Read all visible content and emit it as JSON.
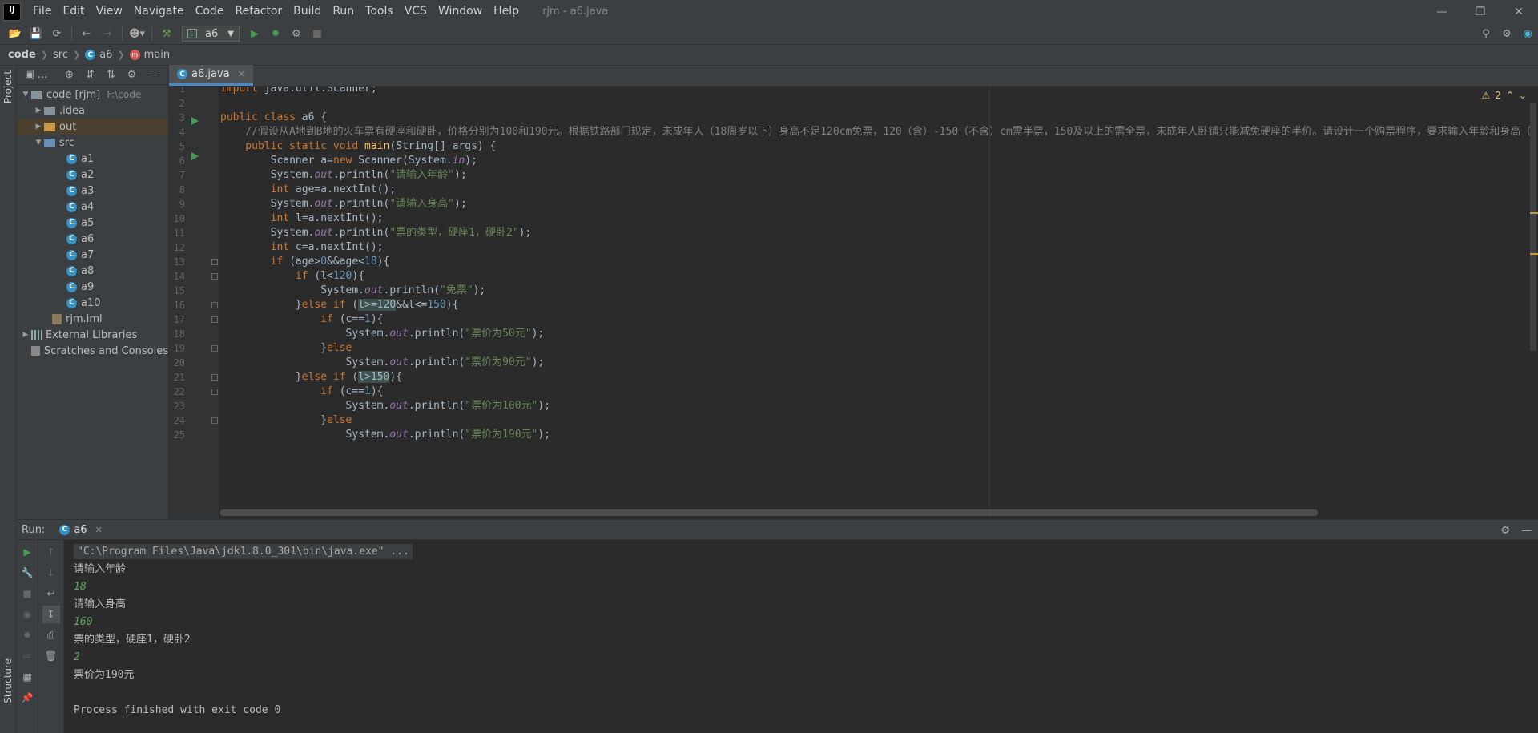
{
  "menubar": {
    "logo": "IJ",
    "items": [
      "File",
      "Edit",
      "View",
      "Navigate",
      "Code",
      "Refactor",
      "Build",
      "Run",
      "Tools",
      "VCS",
      "Window",
      "Help"
    ],
    "window_title": "rjm - a6.java"
  },
  "toolbar": {
    "run_config": "a6"
  },
  "breadcrumb": {
    "items": [
      "code",
      "src",
      "a6",
      "main"
    ]
  },
  "left_strip": {
    "project_label": "Project",
    "structure_label": "Structure"
  },
  "project": {
    "header_dropdown": "...",
    "root_label": "code [rjm]",
    "root_path": "F:\\code",
    "idea": ".idea",
    "out": "out",
    "src": "src",
    "classes": [
      "a1",
      "a2",
      "a3",
      "a4",
      "a5",
      "a6",
      "a7",
      "a8",
      "a9",
      "a10"
    ],
    "iml": "rjm.iml",
    "external_libraries": "External Libraries",
    "scratches": "Scratches and Consoles"
  },
  "editor": {
    "tab_label": "a6.java",
    "warnings": "2",
    "lines": [
      {
        "n": "1",
        "segs": [
          [
            "kw",
            "import "
          ],
          [
            "",
            "java.util.Scanner;"
          ]
        ]
      },
      {
        "n": "2",
        "segs": []
      },
      {
        "n": "3",
        "segs": [
          [
            "kw",
            "public class "
          ],
          [
            "",
            "a6 {"
          ]
        ]
      },
      {
        "n": "4",
        "segs": [
          [
            "cmt",
            "    //假设从A地到B地的火车票有硬座和硬卧，价格分别为100和190元。根据铁路部门规定，未成年人（18周岁以下）身高不足120cm免票，120（含）-150（不含）cm需半票，150及以上的需全票，未成年人卧铺只能减免硬座的半价。请设计一个购票程序，要求输入年龄和身高（"
          ]
        ]
      },
      {
        "n": "5",
        "segs": [
          [
            "kw",
            "    public static void "
          ],
          [
            "fn",
            "main"
          ],
          [
            "",
            "(String[] args) {"
          ]
        ]
      },
      {
        "n": "6",
        "segs": [
          [
            "",
            "        Scanner a="
          ],
          [
            "kw",
            "new "
          ],
          [
            "",
            "Scanner(System."
          ],
          [
            "fld",
            "in"
          ],
          [
            "",
            ");"
          ]
        ]
      },
      {
        "n": "7",
        "segs": [
          [
            "",
            "        System."
          ],
          [
            "fld",
            "out"
          ],
          [
            "",
            ".println("
          ],
          [
            "str",
            "\"请输入年龄\""
          ],
          [
            "",
            ");"
          ]
        ]
      },
      {
        "n": "8",
        "segs": [
          [
            "kw",
            "        int "
          ],
          [
            "",
            "age=a.nextInt();"
          ]
        ]
      },
      {
        "n": "9",
        "segs": [
          [
            "",
            "        System."
          ],
          [
            "fld",
            "out"
          ],
          [
            "",
            ".println("
          ],
          [
            "str",
            "\"请输入身高\""
          ],
          [
            "",
            ");"
          ]
        ]
      },
      {
        "n": "10",
        "segs": [
          [
            "kw",
            "        int "
          ],
          [
            "",
            "l=a.nextInt();"
          ]
        ]
      },
      {
        "n": "11",
        "segs": [
          [
            "",
            "        System."
          ],
          [
            "fld",
            "out"
          ],
          [
            "",
            ".println("
          ],
          [
            "str",
            "\"票的类型，硬座1，硬卧2\""
          ],
          [
            "",
            ");"
          ]
        ]
      },
      {
        "n": "12",
        "segs": [
          [
            "kw",
            "        int "
          ],
          [
            "",
            "c=a.nextInt();"
          ]
        ]
      },
      {
        "n": "13",
        "segs": [
          [
            "kw",
            "        if "
          ],
          [
            "",
            "(age>"
          ],
          [
            "num",
            "0"
          ],
          [
            "",
            "&&age<"
          ],
          [
            "num",
            "18"
          ],
          [
            "",
            "){"
          ]
        ]
      },
      {
        "n": "14",
        "segs": [
          [
            "kw",
            "            if "
          ],
          [
            "",
            "(l<"
          ],
          [
            "num",
            "120"
          ],
          [
            "",
            "){"
          ]
        ]
      },
      {
        "n": "15",
        "segs": [
          [
            "",
            "                System."
          ],
          [
            "fld",
            "out"
          ],
          [
            "",
            ".println("
          ],
          [
            "str",
            "\"免票\""
          ],
          [
            "",
            ");"
          ]
        ]
      },
      {
        "n": "16",
        "segs": [
          [
            "",
            "            }"
          ],
          [
            "kw",
            "else if "
          ],
          [
            "",
            "("
          ],
          [
            "hl",
            "l>=120"
          ],
          [
            "",
            "&&l<="
          ],
          [
            "num",
            "150"
          ],
          [
            "",
            "){"
          ]
        ]
      },
      {
        "n": "17",
        "segs": [
          [
            "kw",
            "                if "
          ],
          [
            "",
            "(c=="
          ],
          [
            "num",
            "1"
          ],
          [
            "",
            "){"
          ]
        ]
      },
      {
        "n": "18",
        "segs": [
          [
            "",
            "                    System."
          ],
          [
            "fld",
            "out"
          ],
          [
            "",
            ".println("
          ],
          [
            "str",
            "\"票价为50元\""
          ],
          [
            "",
            ");"
          ]
        ]
      },
      {
        "n": "19",
        "segs": [
          [
            "",
            "                }"
          ],
          [
            "kw",
            "else"
          ]
        ]
      },
      {
        "n": "20",
        "segs": [
          [
            "",
            "                    System."
          ],
          [
            "fld",
            "out"
          ],
          [
            "",
            ".println("
          ],
          [
            "str",
            "\"票价为90元\""
          ],
          [
            "",
            ");"
          ]
        ]
      },
      {
        "n": "21",
        "segs": [
          [
            "",
            "            }"
          ],
          [
            "kw",
            "else if "
          ],
          [
            "",
            "("
          ],
          [
            "hl",
            "l>150"
          ],
          [
            "",
            "){"
          ]
        ]
      },
      {
        "n": "22",
        "segs": [
          [
            "kw",
            "                if "
          ],
          [
            "",
            "(c=="
          ],
          [
            "num",
            "1"
          ],
          [
            "",
            "){"
          ]
        ]
      },
      {
        "n": "23",
        "segs": [
          [
            "",
            "                    System."
          ],
          [
            "fld",
            "out"
          ],
          [
            "",
            ".println("
          ],
          [
            "str",
            "\"票价为100元\""
          ],
          [
            "",
            ");"
          ]
        ]
      },
      {
        "n": "24",
        "segs": [
          [
            "",
            "                }"
          ],
          [
            "kw",
            "else"
          ]
        ]
      },
      {
        "n": "25",
        "segs": [
          [
            "",
            "                    System."
          ],
          [
            "fld",
            "out"
          ],
          [
            "",
            ".println("
          ],
          [
            "str",
            "\"票价为190元\""
          ],
          [
            "",
            ");"
          ]
        ]
      }
    ]
  },
  "run": {
    "label": "Run:",
    "tab": "a6",
    "console": [
      {
        "kind": "cmd",
        "text": "\"C:\\Program Files\\Java\\jdk1.8.0_301\\bin\\java.exe\" ..."
      },
      {
        "kind": "out",
        "text": "请输入年龄"
      },
      {
        "kind": "input",
        "text": "18"
      },
      {
        "kind": "out",
        "text": "请输入身高"
      },
      {
        "kind": "input",
        "text": "160"
      },
      {
        "kind": "out",
        "text": "票的类型，硬座1，硬卧2"
      },
      {
        "kind": "input",
        "text": "2"
      },
      {
        "kind": "out",
        "text": "票价为190元"
      },
      {
        "kind": "out",
        "text": ""
      },
      {
        "kind": "out",
        "text": "Process finished with exit code 0"
      }
    ]
  }
}
